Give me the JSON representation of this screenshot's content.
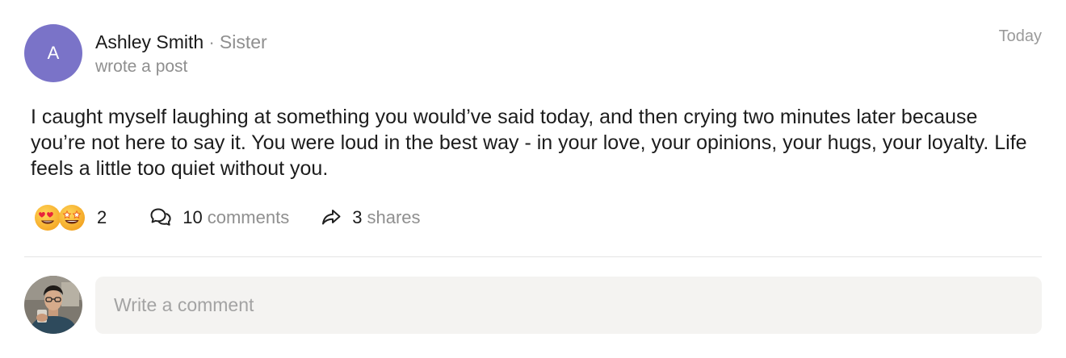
{
  "post": {
    "author": {
      "initial": "A",
      "name": "Ashley Smith",
      "separator": "·",
      "relation": "Sister",
      "avatar_color": "#7a73c8"
    },
    "action_text": "wrote a post",
    "timestamp": "Today",
    "body": "I caught myself laughing at something you would’ve said today, and then crying two minutes later because you’re not here to say it. You were loud in the best way - in your love, your opinions, your hugs, your loyalty. Life feels a little too quiet without you."
  },
  "stats": {
    "reactions": {
      "icons": [
        "heart-eyes-emoji-icon",
        "star-struck-emoji-icon"
      ],
      "count": "2"
    },
    "comments": {
      "icon": "comment-bubbles-icon",
      "count": "10",
      "label": "comments"
    },
    "shares": {
      "icon": "share-arrow-icon",
      "count": "3",
      "label": "shares"
    }
  },
  "composer": {
    "placeholder": "Write a comment",
    "value": ""
  },
  "colors": {
    "avatar": "#7a73c8",
    "muted_text": "#8f8f8f",
    "input_bg": "#f4f3f1",
    "divider": "#e4e4e4"
  }
}
